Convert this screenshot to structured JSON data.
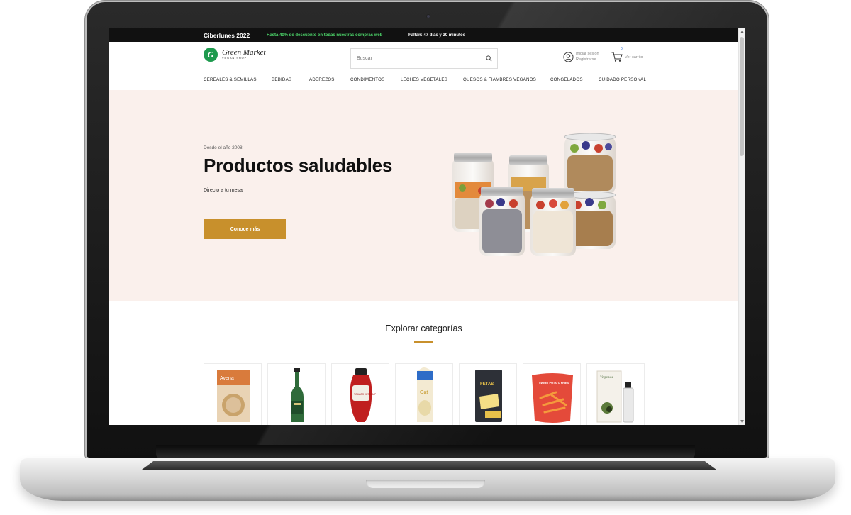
{
  "promo": {
    "title": "Ciberlunes 2022",
    "discount": "Hasta 40% de descuento en todas nuestras compras web",
    "countdown": "Faltan: 47 días y 30 minutos"
  },
  "brand": {
    "initial": "G",
    "name": "Green Market",
    "tagline": "VEGAN SHOP",
    "color": "#1e9a4e"
  },
  "search": {
    "placeholder": "Buscar"
  },
  "account": {
    "login": "Iniciar sesión",
    "register": "Registrarse"
  },
  "cart": {
    "count": "0",
    "label": "Ver carrito"
  },
  "nav": [
    "CEREALES & SEMILLAS",
    "BEBIDAS",
    "ADEREZOS",
    "CONDIMENTOS",
    "LECHES VEGETALES",
    "QUESOS & FIAMBRES VEGANOS",
    "CONGELADOS",
    "CUIDADO PERSONAL"
  ],
  "hero": {
    "eyebrow": "Desde el año 2008",
    "title": "Productos saludables",
    "subtitle": "Directo a tu mesa",
    "cta": "Conoce más",
    "background": "#faf0ec",
    "accent": "#c8902c"
  },
  "categories": {
    "title": "Explorar categorías",
    "items": [
      {
        "icon": "cereal-box-icon",
        "box_text": "Avena"
      },
      {
        "icon": "bottle-icon"
      },
      {
        "icon": "ketchup-icon",
        "box_text": "TOMATO KETCHUP"
      },
      {
        "icon": "milk-carton-icon",
        "box_text": "Oat"
      },
      {
        "icon": "cheese-pack-icon",
        "box_text": "FETAS"
      },
      {
        "icon": "fries-bag-icon",
        "box_text": "SWEET POTATO FRIES"
      },
      {
        "icon": "oil-box-icon",
        "box_text": "Veganas"
      }
    ]
  }
}
